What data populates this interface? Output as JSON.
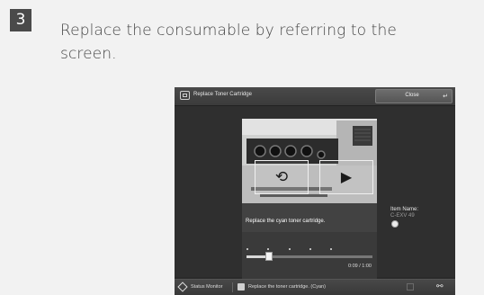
{
  "step": {
    "number": "3",
    "text": "Replace the consumable by referring to the screen."
  },
  "screen": {
    "title": "Replace Toner Cartridge",
    "close_label": "Close",
    "video_caption": "Replace the cyan toner cartridge.",
    "item_name_label": "Item Name:",
    "item_name_value": "C-EXV 49",
    "time": "0:09 / 1:00",
    "progress": 0.15,
    "status_monitor_label": "Status Monitor",
    "status_message": "Replace the toner cartridge. (Cyan)",
    "colors": {
      "step_badge": "#4a4a4a",
      "panel_bg": "#2b2b2b",
      "titlebar": "#404040"
    },
    "icons": [
      "replace-screen-icon",
      "return-arrow-icon",
      "rotate-icon",
      "play-icon",
      "previous-icon",
      "next-icon",
      "status-monitor-icon",
      "message-icon",
      "network-icon"
    ]
  }
}
